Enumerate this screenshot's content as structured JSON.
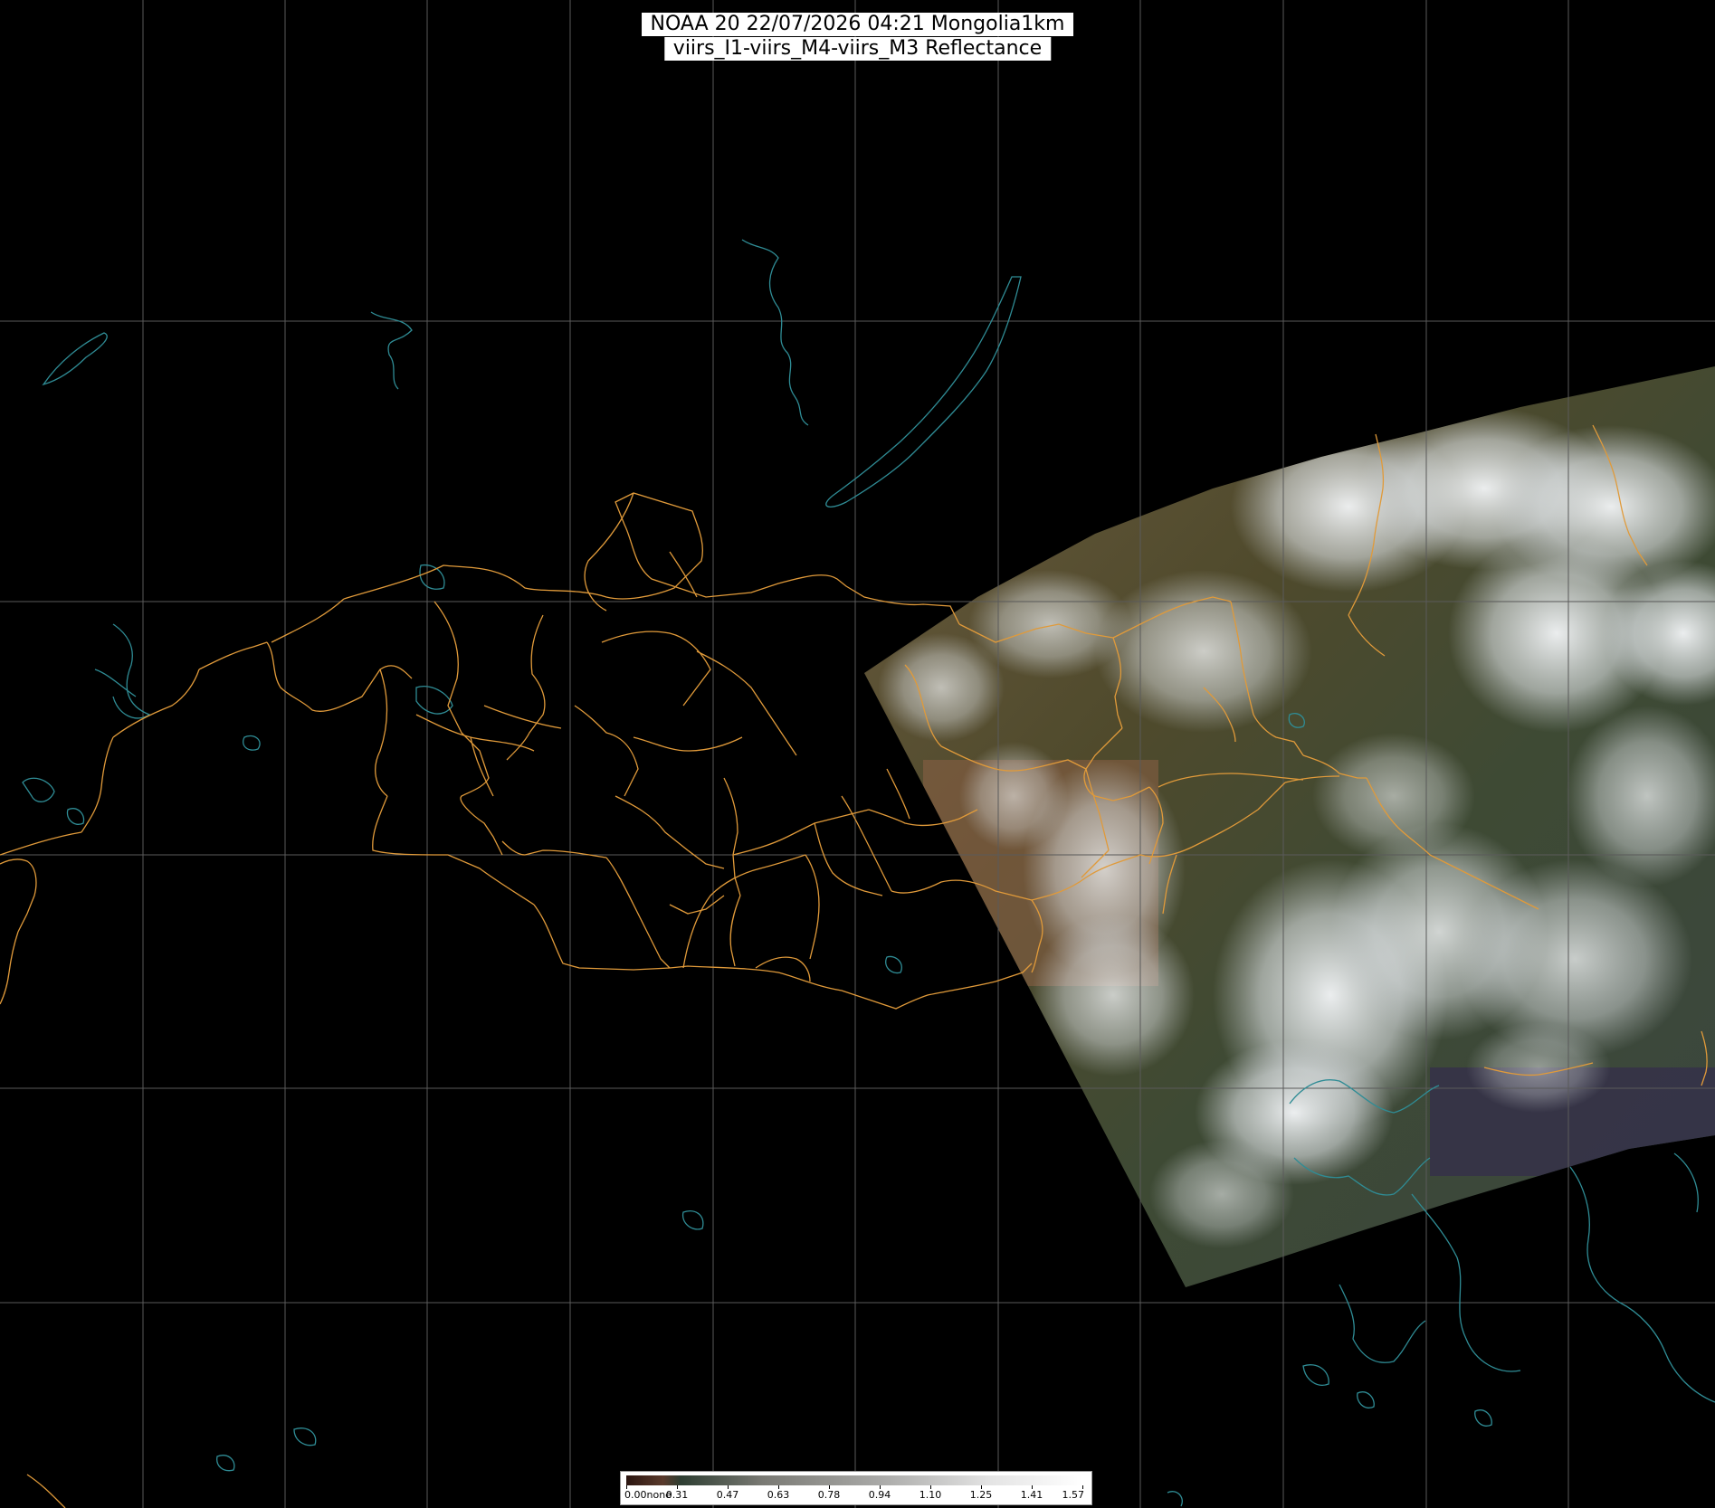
{
  "header": {
    "line1": "NOAA 20 22/07/2026 04:21 Mongolia1km",
    "line2": "viirs_I1-viirs_M4-viirs_M3 Reflectance"
  },
  "legend": {
    "labels": [
      "0.00none",
      "0.31",
      "0.47",
      "0.63",
      "0.78",
      "0.94",
      "1.10",
      "1.25",
      "1.41",
      "1.57"
    ]
  },
  "colors": {
    "background": "#000000",
    "graticule": "#5a5a5a",
    "admin_borders": "#e09a3a",
    "coastlines_lakes": "#2f8c95",
    "clouds": "#eef0f2",
    "land": "#5b5030"
  }
}
